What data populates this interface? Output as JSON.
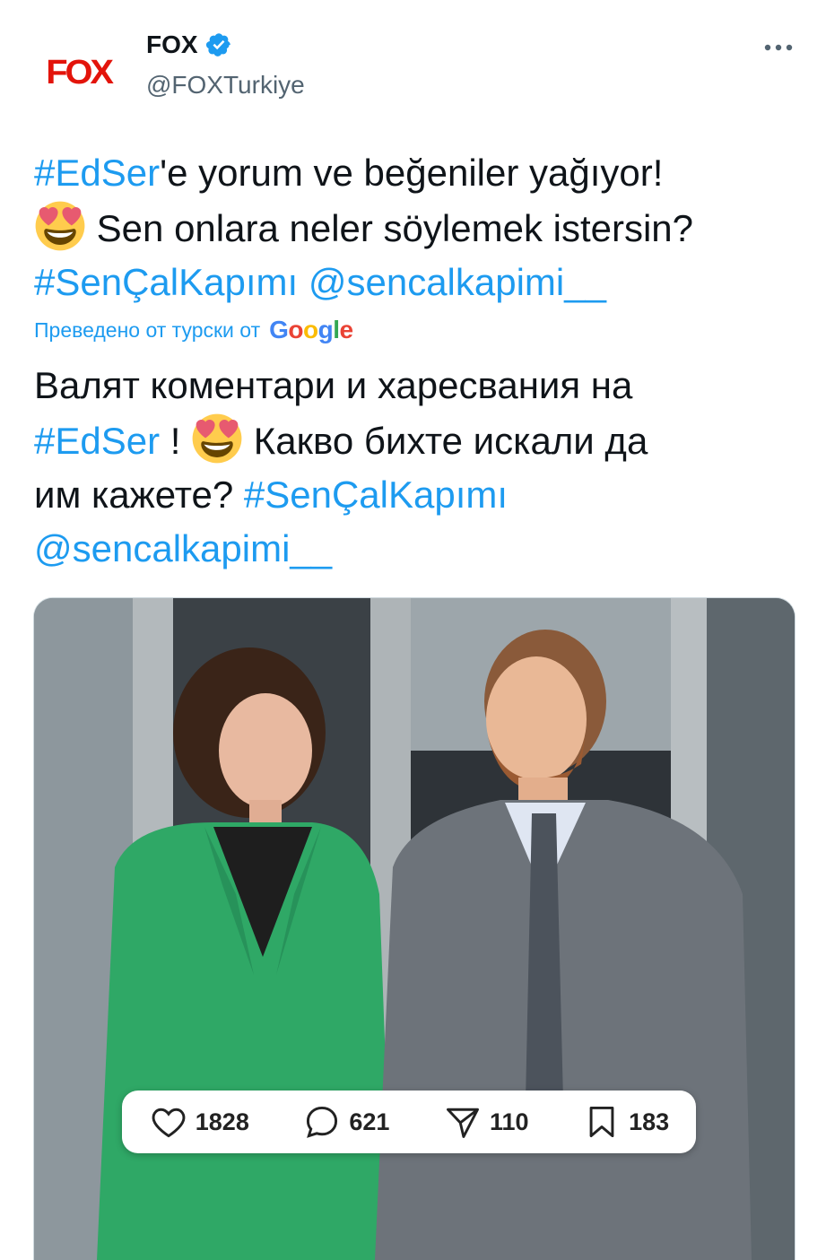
{
  "account": {
    "avatar_text": "FOX",
    "name": "FOX",
    "handle": "@FOXTurkiye",
    "verified": true
  },
  "tweet": {
    "line1_tag": "#EdSer",
    "line1_rest": "'e yorum ve beğeniler yağıyor!",
    "line2": " Sen onlara neler söylemek istersin?",
    "line3_tag1": "#SenÇalKapımı",
    "line3_tag2": "@sencalkapimi__"
  },
  "translation_label": "Преведено от турски от",
  "translation_provider": {
    "letters": [
      "G",
      "o",
      "o",
      "g",
      "l",
      "e"
    ]
  },
  "translation": {
    "line1": "Валят коментари и харесвания на",
    "line2_tag": "#EdSer",
    "line2_rest": " ! ",
    "line2_end": " Какво бихте искали да",
    "line3": "им кажете? ",
    "line3_tag": "#SenÇalKapımı",
    "line4_tag": "@sencalkapimi__"
  },
  "media_stats": {
    "likes": "1828",
    "comments": "621",
    "shares": "110",
    "saves": "183"
  },
  "icons": [
    "verified-badge-icon",
    "more-icon",
    "heart-eyes-emoji-icon",
    "heart-icon",
    "comment-icon",
    "send-icon",
    "bookmark-icon"
  ],
  "colors": {
    "accent": "#1d9bf0",
    "brand": "#e3140b",
    "text": "#0f1419",
    "muted": "#536471"
  }
}
